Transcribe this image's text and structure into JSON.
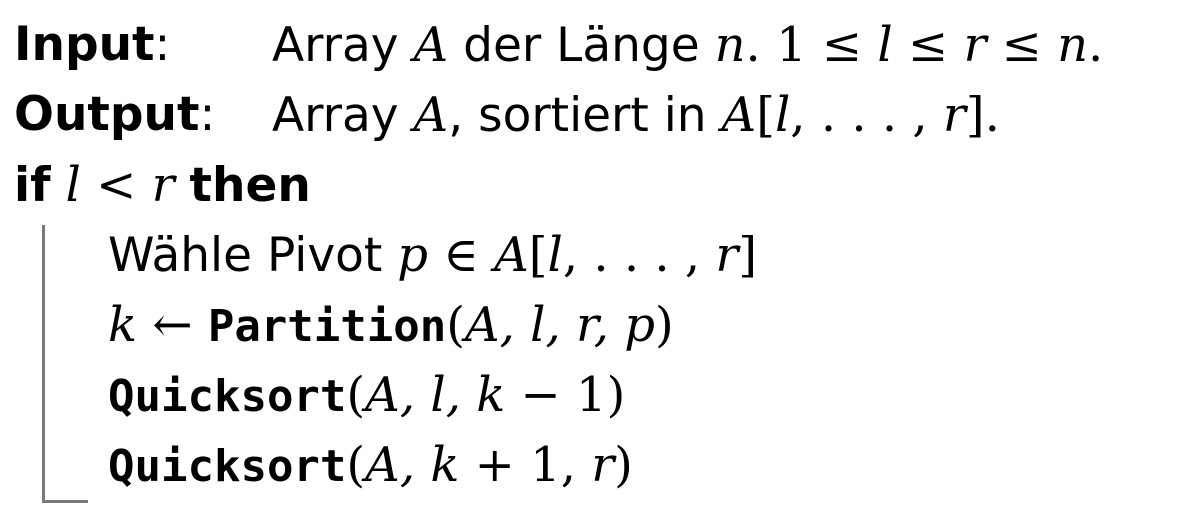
{
  "algorithm": {
    "input": {
      "label": "Input",
      "colon": ":",
      "text_1": "Array ",
      "var_a": "A",
      "text_2": " der Länge ",
      "var_n": "n",
      "text_3": ".  ",
      "constraint_one": "1",
      "leq_1": " ≤ ",
      "var_l": "l",
      "leq_2": " ≤ ",
      "var_r": "r",
      "leq_3": " ≤ ",
      "var_n2": "n",
      "period": "."
    },
    "output": {
      "label": "Output",
      "colon": ":",
      "text_1": "Array ",
      "var_a": "A",
      "text_2": ", sortiert in ",
      "var_a2": "A",
      "bracket_open": "[",
      "var_l": "l",
      "dots": ", . . . , ",
      "var_r": "r",
      "bracket_close": "]",
      "period": "."
    },
    "condition": {
      "if_kw": "if",
      "var_l": "l",
      "lt": " < ",
      "var_r": "r",
      "then_kw": "then"
    },
    "body": {
      "pivot": {
        "text": "Wähle Pivot ",
        "var_p": "p",
        "in": " ∈ ",
        "var_a": "A",
        "bracket_open": "[",
        "var_l": "l",
        "dots": ", . . . , ",
        "var_r": "r",
        "bracket_close": "]"
      },
      "partition": {
        "var_k": "k",
        "arrow": " ← ",
        "fn": "Partition",
        "args_open": "(",
        "args": "A, l, r, p",
        "args_close": ")"
      },
      "quicksort_left": {
        "fn": "Quicksort",
        "args_open": "(",
        "args_vars": "A, l, k",
        "minus": " − ",
        "one": "1",
        "args_close": ")"
      },
      "quicksort_right": {
        "fn": "Quicksort",
        "args_open": "(",
        "args_vars": "A, k",
        "plus": " + ",
        "one": "1",
        "comma_r": ", ",
        "var_r": "r",
        "args_close": ")"
      }
    }
  }
}
